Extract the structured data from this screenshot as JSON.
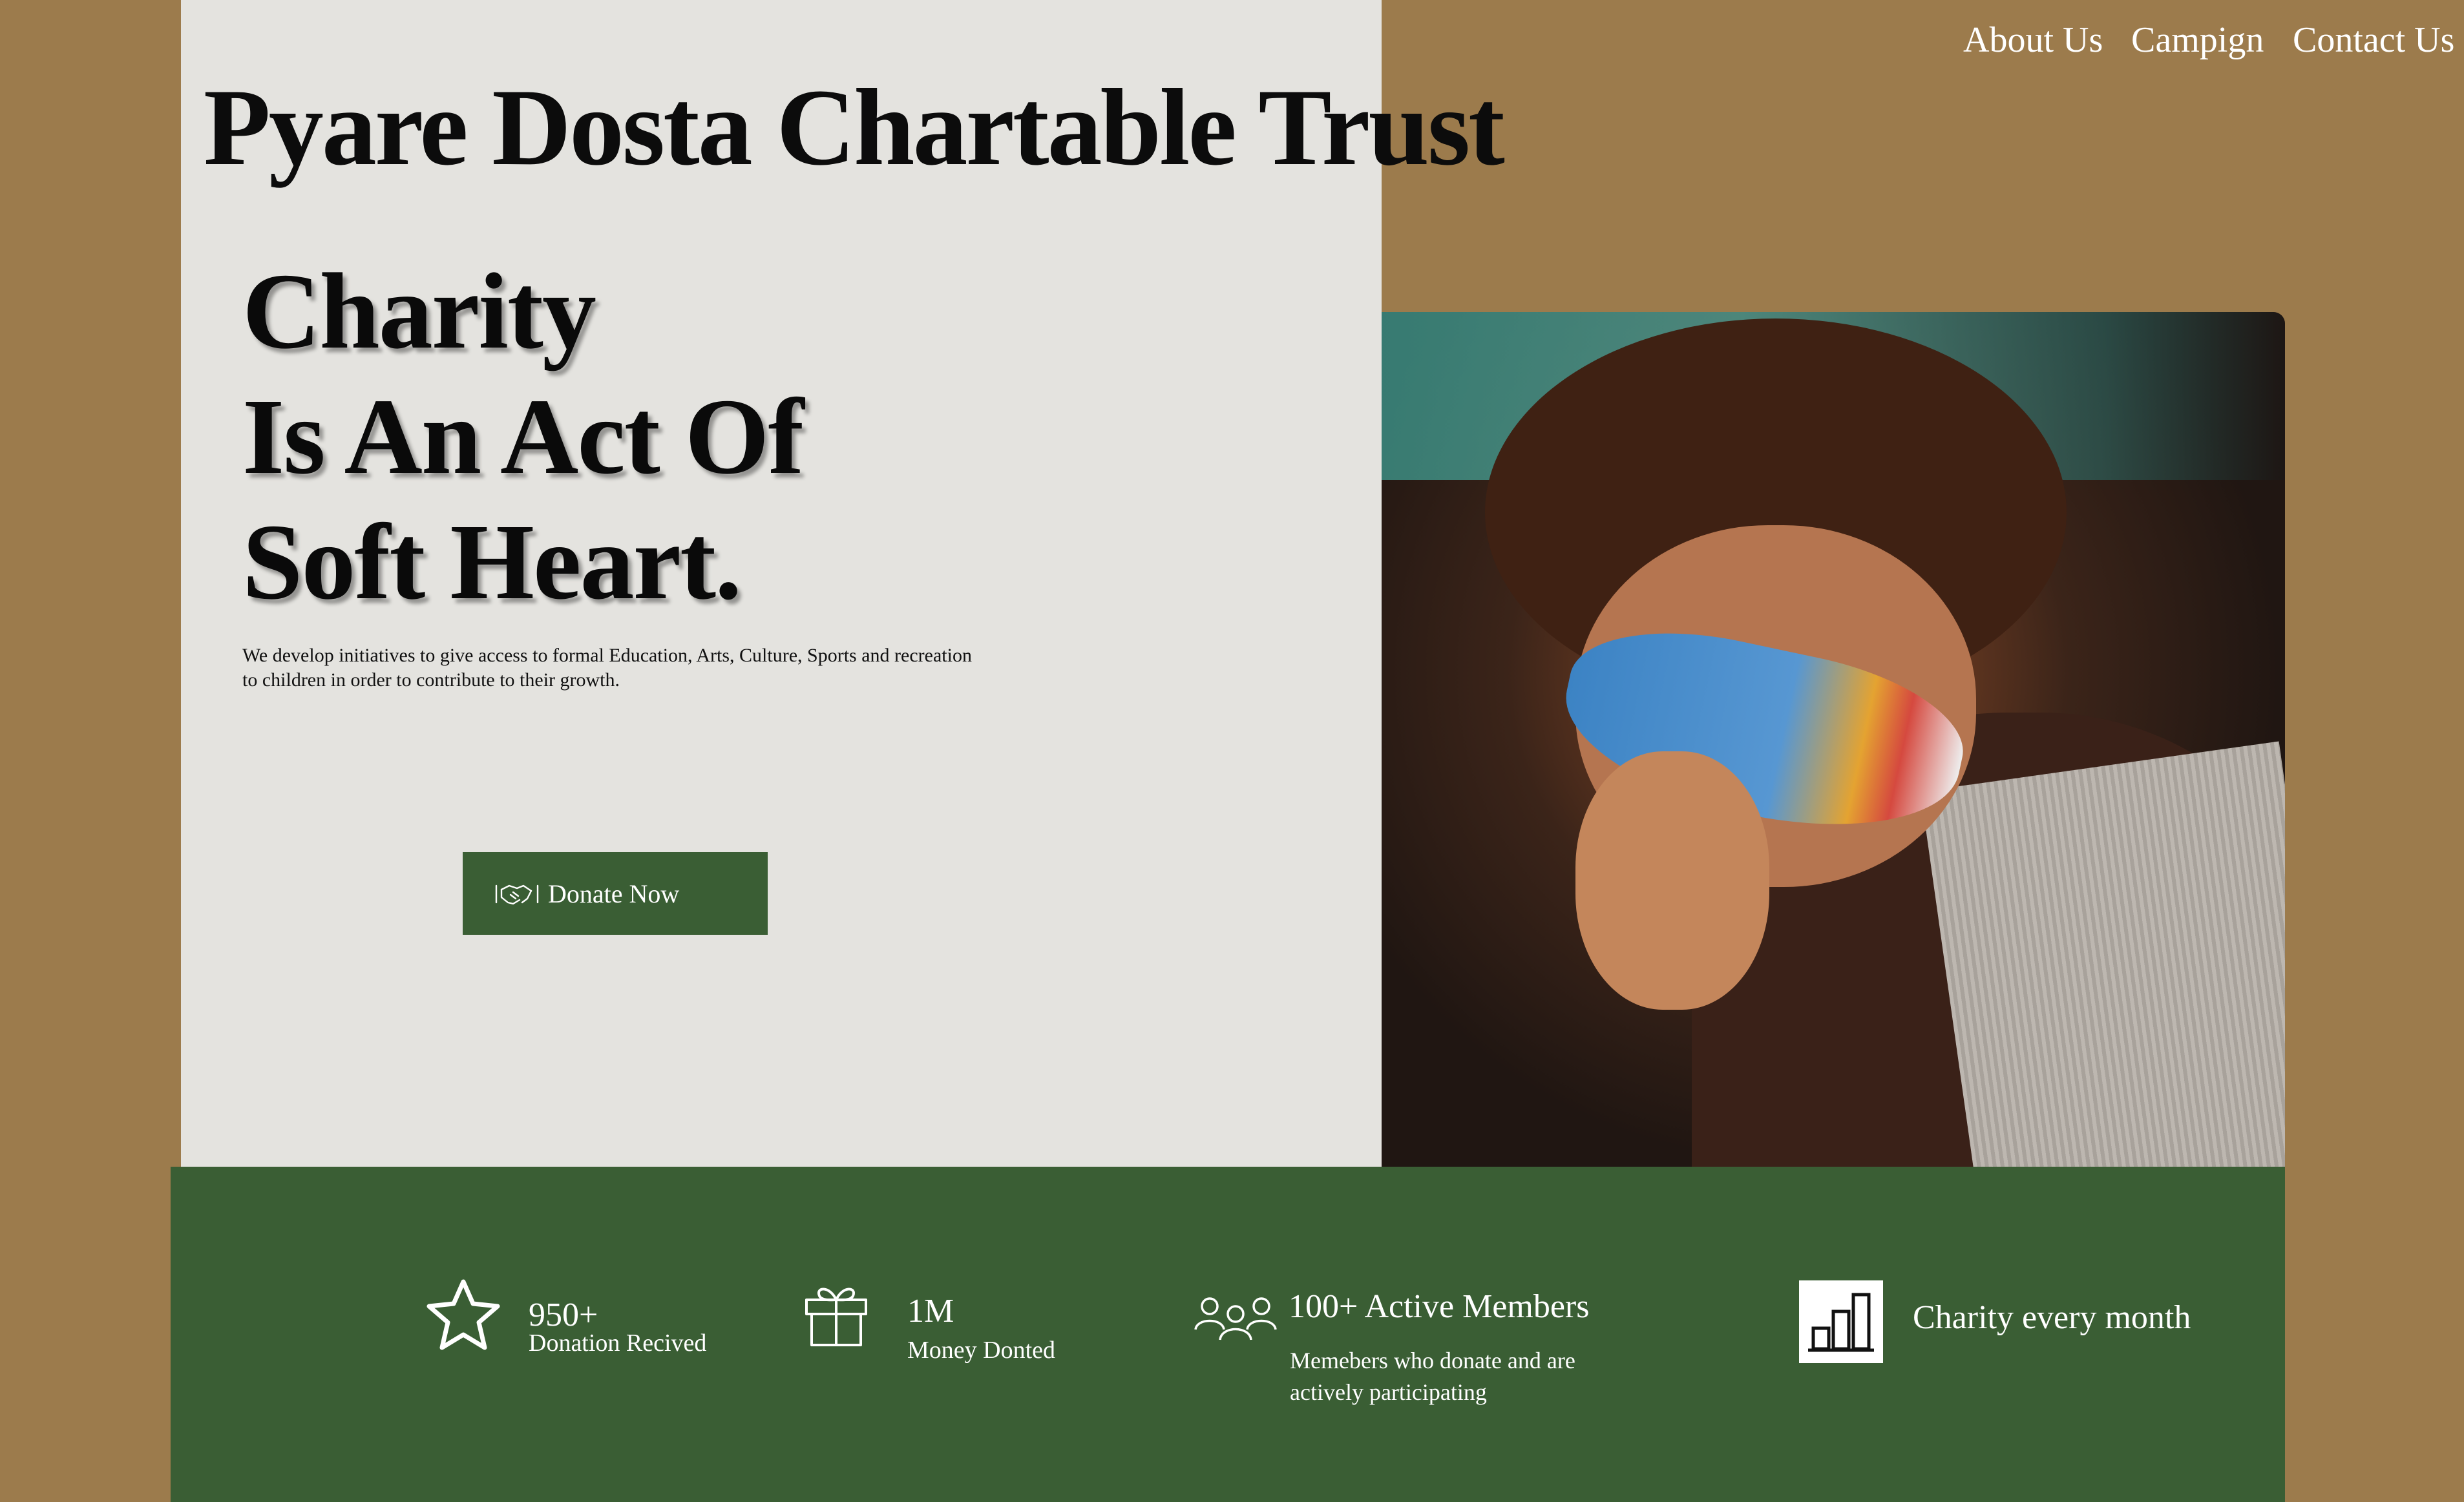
{
  "brand": {
    "name": "Pyare Dosta Chartable Trust"
  },
  "nav": {
    "items": [
      "About Us",
      "Campign",
      "Contact Us"
    ]
  },
  "hero": {
    "headline_lines": [
      "Charity",
      "Is An Act Of",
      "Soft Heart."
    ],
    "intro": "We develop initiatives to give access to formal Education, Arts, Culture, Sports and recreation\n to children in order to contribute to their growth.",
    "donate_button": "Donate Now",
    "donate_icon": "handshake-icon",
    "photo": "child-wearing-face-mask-photo"
  },
  "stats": {
    "donations": {
      "value": "950+",
      "label": "Donation Recived",
      "icon": "star-icon"
    },
    "money": {
      "value": "1M",
      "label": "Money Donted",
      "icon": "gift-icon"
    },
    "members": {
      "value": "100+ Active Members",
      "description": "Memebers who donate and are\nactively participating",
      "icon": "people-icon"
    },
    "monthly": {
      "value": "Charity every month",
      "icon": "bar-chart-icon"
    }
  },
  "colors": {
    "background": "#9c7b4c",
    "hero_panel": "#e4e3df",
    "accent_green": "#3a5e34",
    "text_dark": "#0c0c0c",
    "text_light": "#ffffff"
  }
}
